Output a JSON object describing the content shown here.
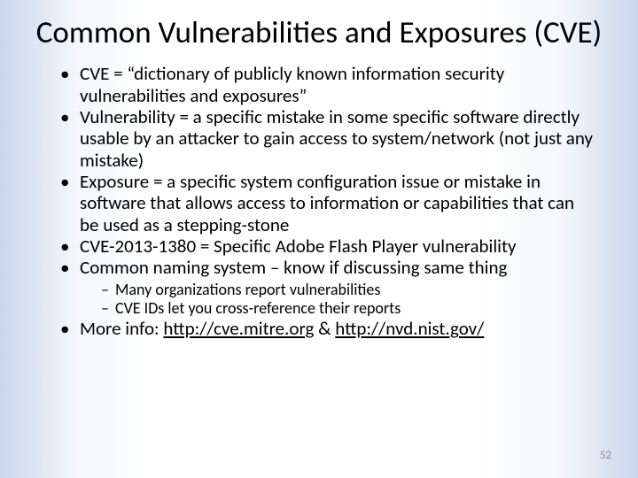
{
  "title": "Common Vulnerabilities and Exposures (CVE)",
  "bullets": {
    "b0": "CVE = “dictionary of publicly known information security vulnerabilities and exposures”",
    "b1": "Vulnerability = a specific mistake in some specific software directly usable by an attacker to gain access to system/network (not just any mistake)",
    "b2": "Exposure = a specific system configuration issue or mistake in software that allows access to information or capabilities that can be used as a stepping-stone",
    "b3": "CVE-2013-1380 = Specific Adobe Flash Player vulnerability",
    "b4": "Common naming system – know if discussing same thing",
    "b4sub": {
      "s0": "Many organizations report vulnerabilities",
      "s1": "CVE IDs let you cross-reference their reports"
    },
    "b5_prefix": "More info: ",
    "b5_link1": "http://cve.mitre.org",
    "b5_sep": " & ",
    "b5_link2": "http://nvd.nist.gov/"
  },
  "page_number": "52"
}
